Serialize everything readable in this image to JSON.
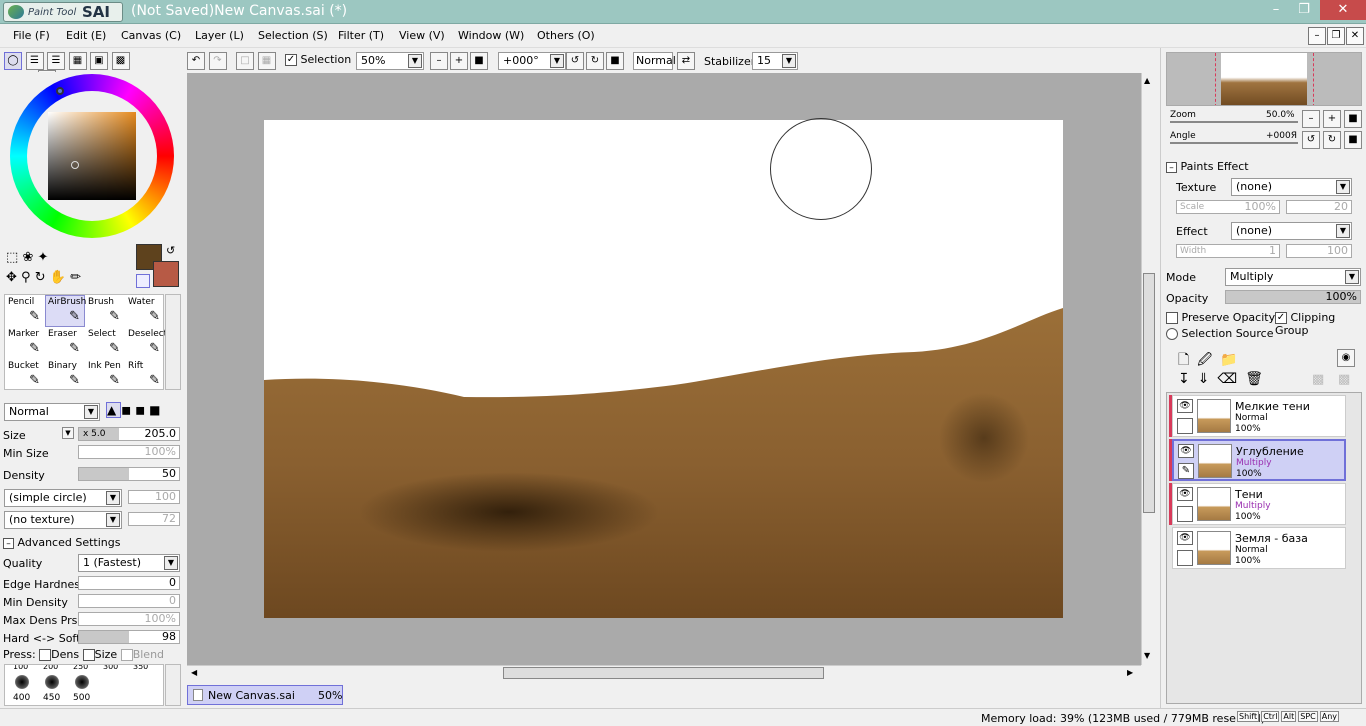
{
  "window": {
    "title": "(Not Saved)New Canvas.sai (*)",
    "logo_text": "Paint Tool",
    "logo_sai": "SAI"
  },
  "menus": [
    "File (F)",
    "Edit (E)",
    "Canvas (C)",
    "Layer (L)",
    "Selection (S)",
    "Filter (T)",
    "View (V)",
    "Window (W)",
    "Others (O)"
  ],
  "toolbar": {
    "selection_label": "Selection",
    "zoom": "50%",
    "angle": "+000°",
    "blend": "Normal",
    "stabilizer_label": "Stabilizer",
    "stabilizer_value": "15"
  },
  "colors": {
    "primary": "#5e421d",
    "secondary": "#b75a45",
    "accent": "#7070d8"
  },
  "tools": [
    {
      "label": "Pencil",
      "icon": "pencil-icon"
    },
    {
      "label": "AirBrush",
      "icon": "airbrush-icon",
      "selected": true
    },
    {
      "label": "Brush",
      "icon": "brush-icon"
    },
    {
      "label": "Water",
      "icon": "water-icon"
    },
    {
      "label": "Marker",
      "icon": "marker-icon"
    },
    {
      "label": "Eraser",
      "icon": "eraser-icon"
    },
    {
      "label": "Select",
      "icon": "select-icon"
    },
    {
      "label": "Deselect",
      "icon": "deselect-icon"
    },
    {
      "label": "Bucket",
      "icon": "bucket-icon"
    },
    {
      "label": "Binary",
      "icon": "binary-icon"
    },
    {
      "label": "Ink Pen",
      "icon": "ink-pen-icon"
    },
    {
      "label": "Rift",
      "icon": "rift-icon"
    }
  ],
  "brush": {
    "mode": "Normal",
    "size_label": "Size",
    "size_mult": "x 5.0",
    "size_value": "205.0",
    "min_size_label": "Min Size",
    "min_size_value": "100%",
    "density_label": "Density",
    "density_value": "50",
    "density_fraction": 0.5,
    "shape": "(simple circle)",
    "shape_value": "100",
    "texture": "(no texture)",
    "texture_value": "72",
    "advanced_label": "Advanced Settings",
    "quality_label": "Quality",
    "quality_value": "1 (Fastest)",
    "edge_label": "Edge Hardness",
    "edge_value": "0",
    "min_density_label": "Min Density",
    "min_density_value": "0",
    "max_dens_label": "Max Dens Prs.",
    "max_dens_value": "100%",
    "hard_soft_label": "Hard <-> Soft",
    "hard_soft_value": "98",
    "hard_soft_fraction": 0.5,
    "press_label": "Press:",
    "press_dens": "Dens",
    "press_size": "Size",
    "press_blend": "Blend"
  },
  "brush_presets": {
    "top": [
      "100",
      "200",
      "250",
      "300",
      "350"
    ],
    "bottom": [
      "400",
      "450",
      "500"
    ]
  },
  "canvas_tab": {
    "name": "New Canvas.sai",
    "zoom": "50%"
  },
  "status": {
    "memory": "Memory load: 39% (123MB used / 779MB reserved)",
    "keys": [
      "Shift",
      "Ctrl",
      "Alt",
      "SPC",
      "Any"
    ]
  },
  "navigator": {
    "zoom_label": "Zoom",
    "zoom_value": "50.0%",
    "angle_label": "Angle",
    "angle_value": "+000Я"
  },
  "paints_effect": {
    "title": "Paints Effect",
    "texture_label": "Texture",
    "texture_value": "(none)",
    "scale_label": "Scale",
    "scale_value": "100%",
    "scale_value2": "20",
    "effect_label": "Effect",
    "effect_value": "(none)",
    "width_label": "Width",
    "width_value": "1",
    "width_value2": "100"
  },
  "layer_props": {
    "mode_label": "Mode",
    "mode_value": "Multiply",
    "opacity_label": "Opacity",
    "opacity_value": "100%",
    "preserve_label": "Preserve Opacity",
    "clipping_label": "Clipping Group",
    "selection_source_label": "Selection Source"
  },
  "layers": [
    {
      "name": "Мелкие тени",
      "mode": "Normal",
      "opacity": "100%",
      "selected": false,
      "clipped": true
    },
    {
      "name": "Углубление",
      "mode": "Multiply",
      "opacity": "100%",
      "selected": true,
      "clipped": true
    },
    {
      "name": "Тени",
      "mode": "Multiply",
      "opacity": "100%",
      "selected": false,
      "clipped": true
    },
    {
      "name": "Земля - база",
      "mode": "Normal",
      "opacity": "100%",
      "selected": false,
      "clipped": false
    }
  ]
}
